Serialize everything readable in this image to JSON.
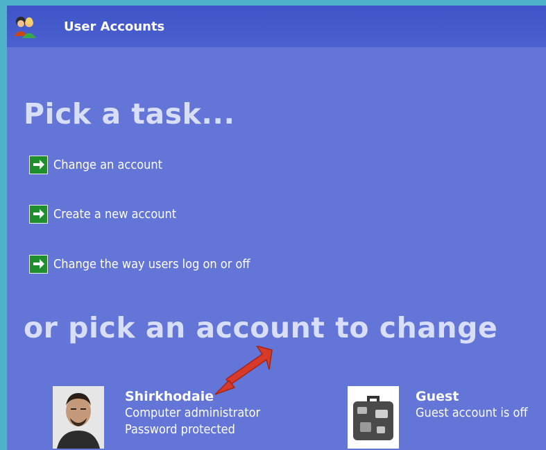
{
  "window": {
    "title": "User Accounts"
  },
  "headings": {
    "pick_task": "Pick a task...",
    "pick_account": "or pick an account to change"
  },
  "tasks": [
    {
      "label": "Change an account"
    },
    {
      "label": "Create a new account"
    },
    {
      "label": "Change the way users log on or off"
    }
  ],
  "accounts": [
    {
      "name": "Shirkhodaie",
      "lines": [
        "Computer administrator",
        "Password protected"
      ],
      "picture": "user-photo"
    },
    {
      "name": "Guest",
      "lines": [
        "Guest account is off"
      ],
      "picture": "suitcase-icon"
    }
  ],
  "colors": {
    "background": "#6375d6",
    "titlebar": "#4357c9",
    "task_arrow": "#1e8f2a",
    "heading": "#d9def8"
  }
}
